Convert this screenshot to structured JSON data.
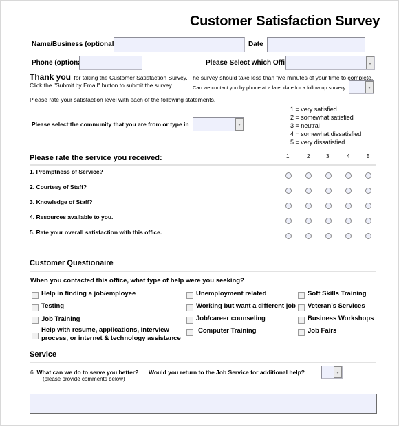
{
  "title": "Customer Satisfaction Survey",
  "header_fields": {
    "name_label": "Name/Business (optional):",
    "name_value": "",
    "date_label": "Date",
    "date_value": "",
    "phone_label": "Phone (optional):",
    "phone_value": "",
    "office_label": "Please Select which Office",
    "office_value": ""
  },
  "intro": {
    "thank_you": "Thank you",
    "line1": "for taking the Customer Satisfaction Survey. The survey should take less than five minutes of your time to complete.",
    "line2": "Click the \"Submit by Email\" button to submit the survey.",
    "followup_label": "Can we contact you by phone at a later date for a follow up survery",
    "followup_value": "",
    "rate_instruction": "Please rate your satisfaction level with each of the following statements.",
    "community_label": "Please select the community that you are from or type in",
    "community_value": ""
  },
  "scale_legend": [
    "1 = very satisfied",
    "2 = somewhat satisfied",
    "3 = neutral",
    "4 = somewhat dissatisfied",
    "5 = very dissatisfied"
  ],
  "rating": {
    "heading": "Please rate the service you received:",
    "columns": [
      "1",
      "2",
      "3",
      "4",
      "5"
    ],
    "questions": [
      "1. Promptness of Service?",
      "2. Courtesy of Staff?",
      "3. Knowledge of Staff?",
      "4. Resources available to you.",
      "5. Rate your overall satisfaction with this office."
    ]
  },
  "questionnaire": {
    "heading": "Customer Questionaire",
    "question": "When you contacted this office, what type of help were you seeking?",
    "options_col1": [
      "Help in finding a job/employee",
      "Testing",
      "Job Training",
      "Help with resume, applications,  interview",
      "process, or internet & technology assistance"
    ],
    "options_col2": [
      "Unemployment related",
      "Working but want a different job",
      "Job/career counseling",
      "Computer Training"
    ],
    "options_col3": [
      "Soft Skills Training",
      "Veteran's Services",
      "Business Workshops",
      "Job Fairs"
    ]
  },
  "service": {
    "heading": "Service",
    "q6_num": "6.",
    "q6_label": "What can we do to serve you better?",
    "q6_sub": "(please provide comments below)",
    "return_label": "Would you return to the Job Service for additional help?",
    "return_value": "",
    "comments_value": ""
  }
}
